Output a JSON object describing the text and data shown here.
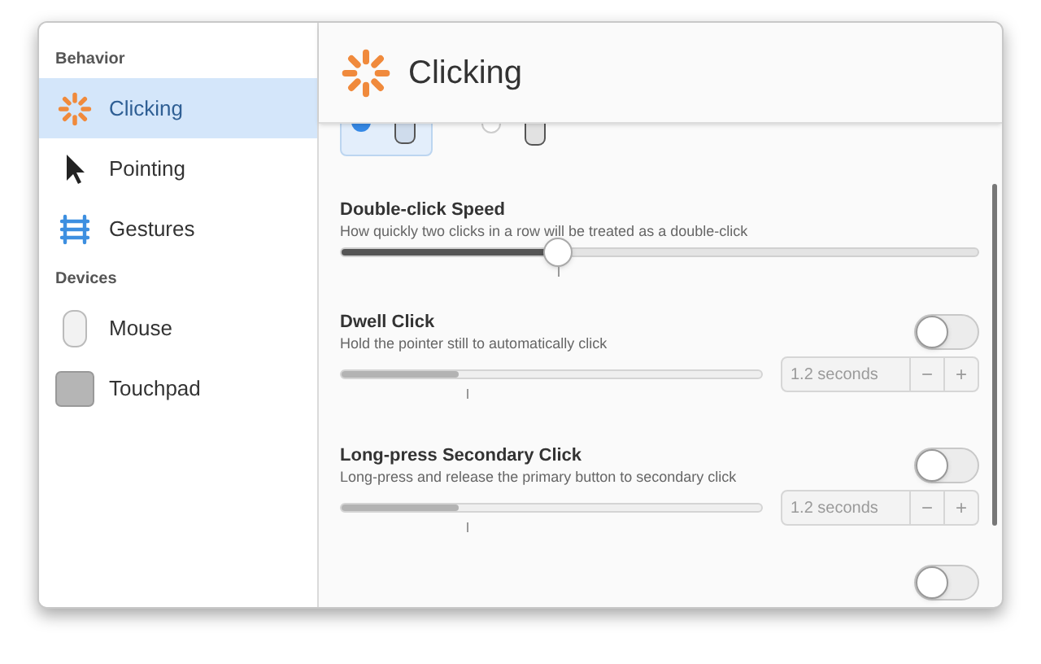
{
  "sidebar": {
    "sections": [
      {
        "heading": "Behavior",
        "items": [
          {
            "label": "Clicking",
            "selected": true
          },
          {
            "label": "Pointing",
            "selected": false
          },
          {
            "label": "Gestures",
            "selected": false
          }
        ]
      },
      {
        "heading": "Devices",
        "items": [
          {
            "label": "Mouse",
            "selected": false
          },
          {
            "label": "Touchpad",
            "selected": false
          }
        ]
      }
    ]
  },
  "header": {
    "title": "Clicking"
  },
  "primary_button": {
    "options": [
      {
        "selected": true
      },
      {
        "selected": false
      }
    ]
  },
  "settings": [
    {
      "kind": "slider",
      "title": "Double-click Speed",
      "description": "How quickly two clicks in a row will be treated as a double-click",
      "level": 0.34
    },
    {
      "kind": "toggle-slider",
      "title": "Dwell Click",
      "description": "Hold the pointer still to automatically click",
      "on": false,
      "level": 0.28,
      "disabled": true,
      "value": "1.2 seconds",
      "minus": "−",
      "plus": "+"
    },
    {
      "kind": "toggle-slider",
      "title": "Long-press Secondary Click",
      "description": "Long-press and release the primary button to secondary click",
      "on": false,
      "level": 0.28,
      "disabled": true,
      "value": "1.2 seconds",
      "minus": "−",
      "plus": "+"
    },
    {
      "kind": "toggle",
      "on": false
    }
  ]
}
